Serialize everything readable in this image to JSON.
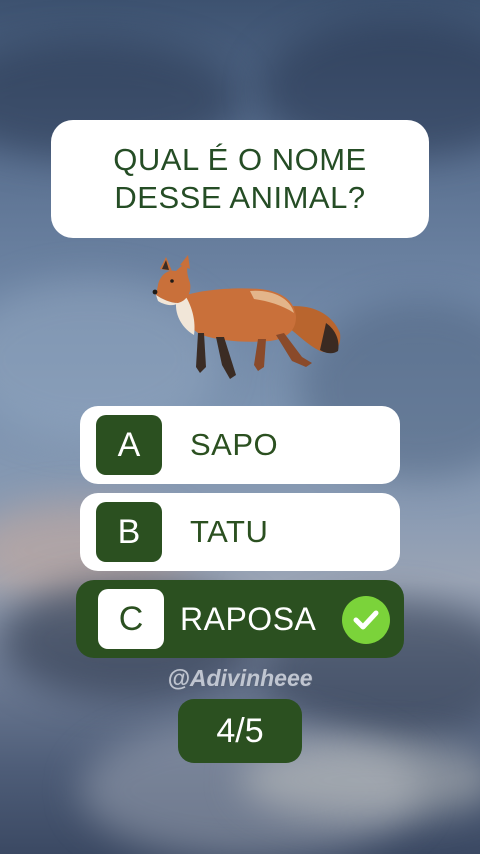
{
  "question": {
    "line1": "QUAL É O NOME",
    "line2": "DESSE ANIMAL?"
  },
  "image": {
    "subject": "fox"
  },
  "options": [
    {
      "letter": "A",
      "text": "SAPO",
      "correct": false
    },
    {
      "letter": "B",
      "text": "TATU",
      "correct": false
    },
    {
      "letter": "C",
      "text": "RAPOSA",
      "correct": true
    }
  ],
  "check_icon": "check-circle-icon",
  "handle": "@Adivinheee",
  "counter": "4/5",
  "colors": {
    "accent_green": "#2b5020",
    "check_green": "#7bd33a",
    "card_white": "#ffffff"
  }
}
